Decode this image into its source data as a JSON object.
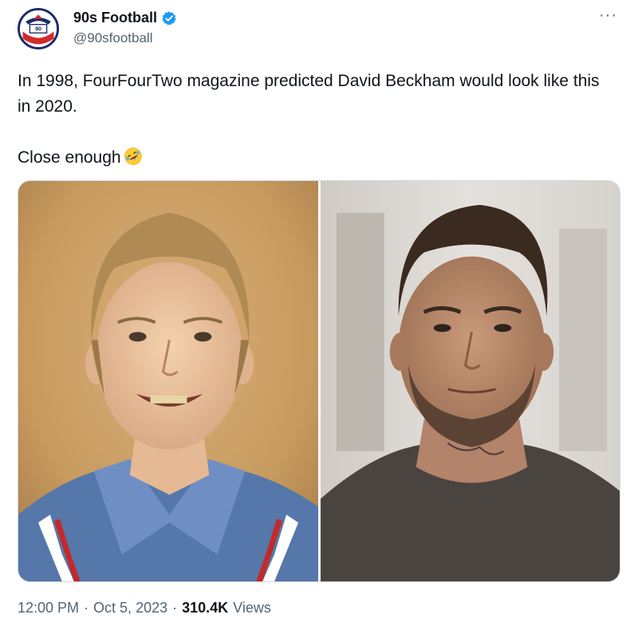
{
  "author": {
    "display_name": "90s Football",
    "handle": "@90sfootball",
    "avatar_icon": "90s-football-crest-icon",
    "verified": true,
    "verified_color": "#1d9bf0"
  },
  "more_icon": "more-dots-icon",
  "tweet": {
    "line1": "In 1998, FourFourTwo magazine predicted David Beckham would look like this in 2020.",
    "line2": "Close enough",
    "emoji": "rolling-on-floor-laughing-emoji"
  },
  "media": {
    "left_image": "predicted-2020-beckham-photo",
    "right_image": "actual-2020-beckham-photo"
  },
  "meta": {
    "time": "12:00 PM",
    "separator": "·",
    "date": "Oct 5, 2023",
    "views_count": "310.4K",
    "views_label": "Views"
  },
  "colors": {
    "text": "#0f1419",
    "secondary": "#536471",
    "border": "#cfd9de"
  }
}
